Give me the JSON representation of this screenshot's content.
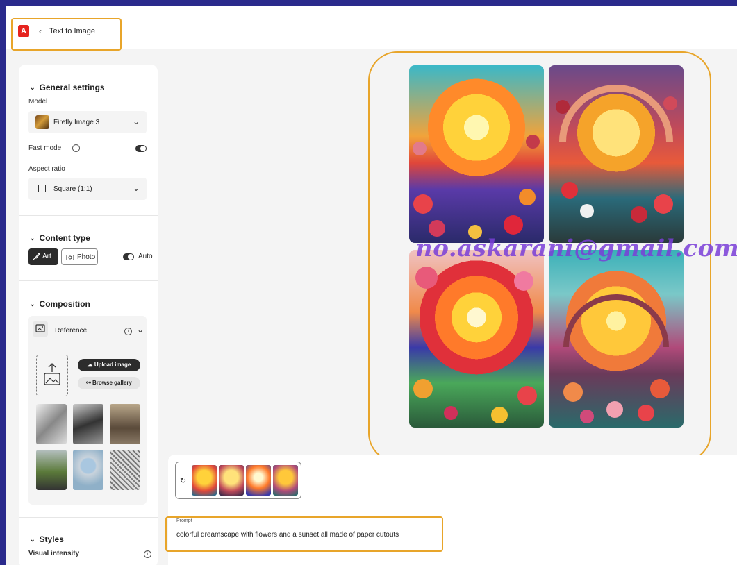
{
  "header": {
    "title": "Text to Image",
    "logo_text": "A"
  },
  "sidebar": {
    "general": {
      "heading": "General settings",
      "model_label": "Model",
      "model_value": "Firefly Image 3",
      "fast_mode_label": "Fast mode",
      "aspect_label": "Aspect ratio",
      "aspect_value": "Square (1:1)"
    },
    "content_type": {
      "heading": "Content type",
      "art_label": "Art",
      "photo_label": "Photo",
      "auto_label": "Auto"
    },
    "composition": {
      "heading": "Composition",
      "reference_label": "Reference",
      "upload_label": "Upload image",
      "browse_label": "Browse gallery"
    },
    "styles": {
      "heading": "Styles",
      "visual_intensity_label": "Visual intensity"
    }
  },
  "watermark": "no.askarani@gmail.com",
  "prompt": {
    "label": "Prompt",
    "text": "colorful dreamscape with flowers and a sunset all made of paper cutouts"
  },
  "colors": {
    "highlight": "#e8a52a",
    "accent_red": "#e6241f",
    "frame": "#2a2a8c"
  }
}
